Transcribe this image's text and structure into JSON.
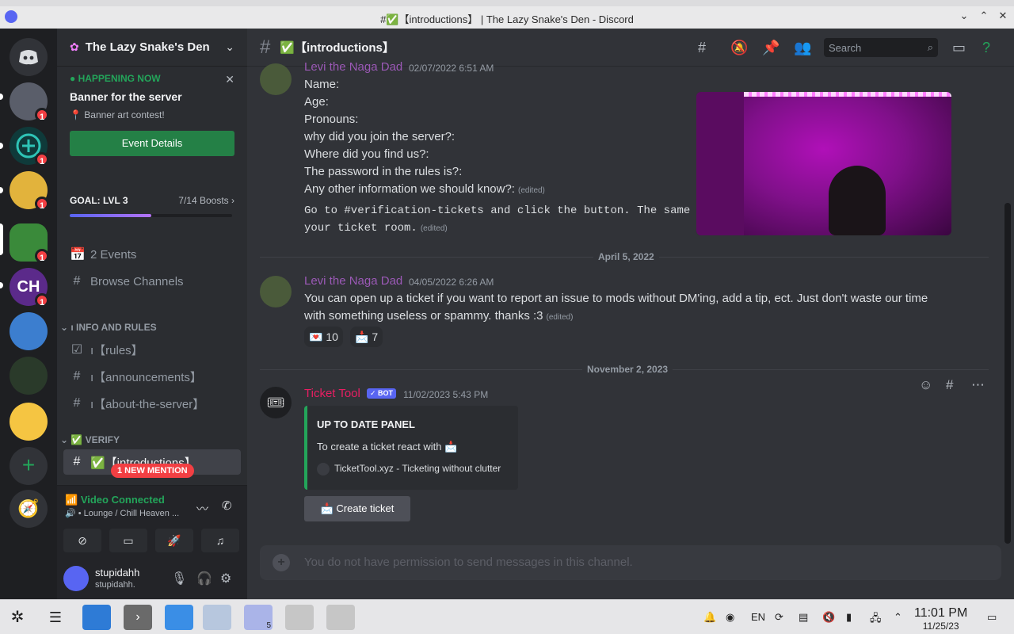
{
  "window": {
    "title": "#✅【introductions】 | The Lazy Snake's Den - Discord"
  },
  "rail": {
    "badges": [
      "1",
      "1",
      "1",
      "1",
      "1"
    ]
  },
  "sidebar": {
    "guild_name": "The Lazy Snake's Den",
    "event": {
      "status": "HAPPENING NOW",
      "title": "Banner for the server",
      "location": "Banner art contest!",
      "button": "Event Details"
    },
    "boost": {
      "goal": "GOAL: LVL 3",
      "count": "7/14 Boosts",
      "progress_fraction": 0.5
    },
    "events_label": "2 Events",
    "browse_label": "Browse Channels",
    "categories": [
      {
        "name": "ı INFO AND RULES",
        "channels": [
          "ı【rules】",
          "ı【announcements】",
          "ı【about-the-server】"
        ]
      },
      {
        "name": "✅ VERIFY",
        "channels": [
          "✅【introductions】"
        ]
      }
    ],
    "mention_pill": "1 NEW MENTION",
    "voice": {
      "status": "Video Connected",
      "location": "Lounge / Chill Heaven ..."
    },
    "user": {
      "name": "stupidahh",
      "tag": "stupidahh."
    }
  },
  "main": {
    "channel_name": "✅【introductions】",
    "search_placeholder": "Search",
    "messages": [
      {
        "author": "Levi the Naga Dad",
        "time": "02/07/2022 6:51 AM",
        "lines": [
          "Name:",
          "Age:",
          "Pronouns:",
          "why did you join the server?:",
          "Where did you find us?:",
          "The password in the rules is?:",
          "Any other information we should know?:"
        ],
        "edited": "(edited)",
        "code_line1": "Go to #verification-tickets and click the button. The same fo",
        "code_line2": "your ticket room."
      },
      {
        "date_divider": "April 5, 2022",
        "author": "Levi the Naga Dad",
        "time": "04/05/2022 6:26 AM",
        "line1": "You can open up a ticket if you want to report an issue to mods without DM'ing, add a tip, ect. Just don't waste our time",
        "line2": "with something useless or spammy. thanks :3",
        "edited": "(edited)",
        "reactions": [
          {
            "emoji": "💌",
            "count": "10"
          },
          {
            "emoji": "📩",
            "count": "7"
          }
        ]
      },
      {
        "date_divider": "November 2, 2023",
        "author": "Ticket Tool",
        "bot_tag": "✓ BOT",
        "time": "11/02/2023 5:43 PM",
        "embed": {
          "title": "UP TO DATE PANEL",
          "description": "To create a ticket react with 📩",
          "footer": "TicketTool.xyz - Ticketing without clutter"
        },
        "button": "📩 Create ticket"
      }
    ],
    "composer_placeholder": "You do not have permission to send messages in this channel."
  },
  "taskbar": {
    "language": "EN",
    "time": "11:01 PM",
    "date": "11/25/23",
    "discord_badge": "5"
  },
  "colors": {
    "accent": "#5865f2",
    "green": "#23a55a",
    "mention": "#f23f43",
    "levi_name": "#9b59b6",
    "ticket_name": "#e91e63"
  }
}
